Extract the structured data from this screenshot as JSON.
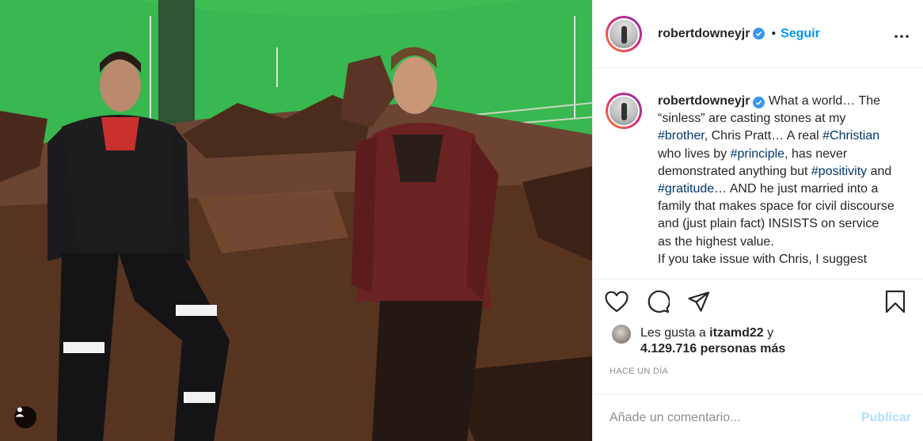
{
  "post": {
    "photo_icon": "user-tag-icon"
  },
  "header": {
    "username": "robertdowneyjr",
    "separator": "•",
    "follow_label": "Seguir"
  },
  "caption": {
    "username": "robertdowneyjr",
    "seg1": " What a world… The “sinless” are casting stones at my ",
    "tag1": "#brother",
    "seg2": ", Chris Pratt… A real ",
    "tag2": "#Christian",
    "seg3": " who lives by ",
    "tag3": "#principle",
    "seg4": ", has never demonstrated anything but ",
    "tag4": "#positivity",
    "seg5": " and ",
    "tag5": "#gratitude",
    "seg6": "… AND he just married into a family that makes space for civil discourse and (just plain fact) INSISTS on service as the highest value.",
    "seg7": "If you take issue with Chris, I suggest"
  },
  "likes": {
    "prefix": "Les gusta a ",
    "user": "itzamd22",
    "suffix": " y",
    "count_line": "4.129.716 personas más"
  },
  "timestamp": "HACE UN DÍA",
  "comment": {
    "placeholder": "Añade un comentario...",
    "publish_label": "Publicar"
  },
  "colors": {
    "link_blue": "#0095f6",
    "hashtag": "#00376b",
    "publish_disabled": "#b2dffc",
    "muted": "#8e8e8e"
  }
}
